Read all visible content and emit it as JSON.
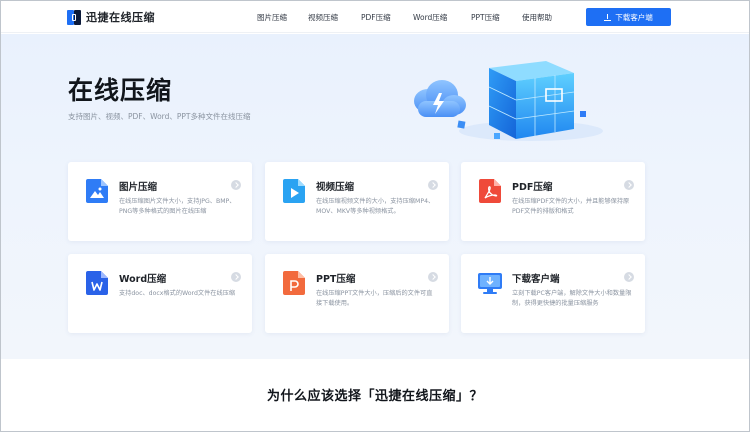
{
  "nav": {
    "logo_text": "迅捷在线压缩",
    "links": [
      "图片压缩",
      "视频压缩",
      "PDF压缩",
      "Word压缩",
      "PPT压缩",
      "使用帮助"
    ],
    "download_label": "下载客户端"
  },
  "hero": {
    "title": "在线压缩",
    "subtitle": "支持图片、视频、PDF、Word、PPT多种文件在线压缩"
  },
  "cards": [
    {
      "title": "图片压缩",
      "desc": "在线压缩图片文件大小，支持JPG、BMP、PNG等多种格式的图片在线压缩",
      "icon": "image-file-icon"
    },
    {
      "title": "视频压缩",
      "desc": "在线压缩视频文件的大小，支持压缩MP4、MOV、MKV等多种视频格式。",
      "icon": "video-file-icon"
    },
    {
      "title": "PDF压缩",
      "desc": "在线压缩PDF文件的大小，并且能够保持原PDF文件的排版和格式",
      "icon": "pdf-file-icon"
    },
    {
      "title": "Word压缩",
      "desc": "支持doc、docx格式的Word文件在线压缩",
      "icon": "word-file-icon"
    },
    {
      "title": "PPT压缩",
      "desc": "在线压缩PPT文件大小，压缩后的文件可直接下载使用。",
      "icon": "ppt-file-icon"
    },
    {
      "title": "下载客户端",
      "desc": "立刻下载PC客户端，解除文件大小和数量限制，获得更快捷的批量压缩服务",
      "icon": "monitor-download-icon"
    }
  ],
  "why_heading": "为什么应该选择「迅捷在线压缩」？",
  "colors": {
    "accent": "#1e6ff4",
    "image": "#2f7cf6",
    "video": "#2aa3f2",
    "pdf": "#ef4a3a",
    "word": "#2a62e8",
    "ppt": "#f26a3d"
  }
}
